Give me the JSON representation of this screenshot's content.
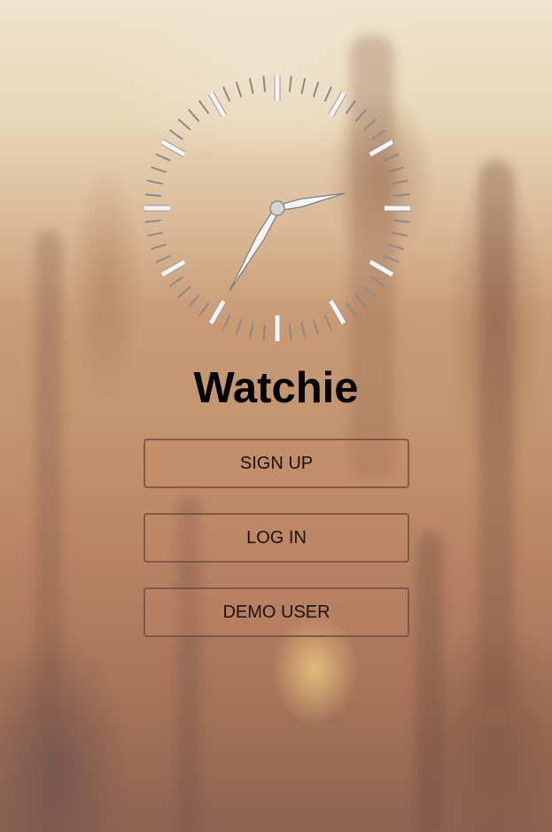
{
  "app": {
    "title": "Watchie"
  },
  "clock": {
    "hour": 2,
    "minute": 35,
    "face_color": "#f4f4f4",
    "tick_color": "#8a8a8a"
  },
  "actions": {
    "signup_label": "SIGN UP",
    "login_label": "LOG IN",
    "demo_label": "DEMO USER"
  },
  "colors": {
    "background_top": "#efe4cc",
    "background_bottom": "#8d6352",
    "button_border": "#6e4b3c",
    "title_color": "#000000"
  }
}
